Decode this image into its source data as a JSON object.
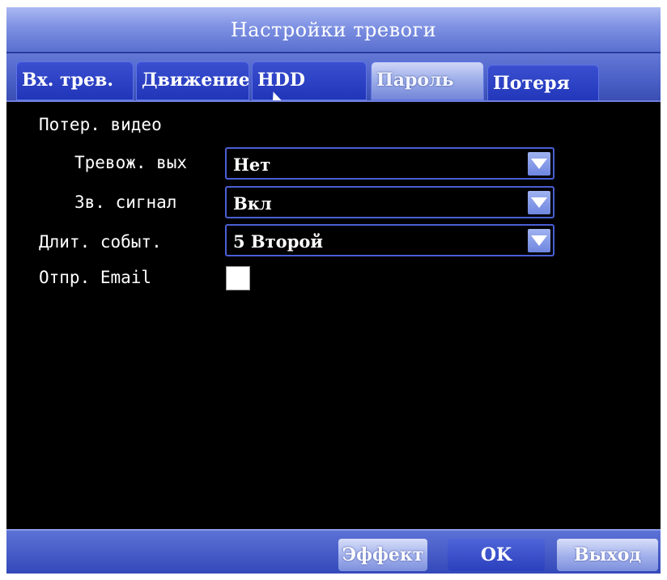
{
  "window": {
    "title": "Настройки тревоги"
  },
  "tabs": [
    {
      "label": "Вх. трев.",
      "state": "normal"
    },
    {
      "label": "Движение",
      "state": "normal"
    },
    {
      "label": "HDD",
      "state": "normal"
    },
    {
      "label": "Пароль",
      "state": "highlighted"
    },
    {
      "label": "Потеря",
      "state": "normal"
    }
  ],
  "section": {
    "heading": "Потер. видео"
  },
  "settings": {
    "alarm_out": {
      "label": "Тревож. вых",
      "value": "Нет"
    },
    "sound": {
      "label": "Зв. сигнал",
      "value": "Вкл"
    },
    "event_duration": {
      "label": "Длит. событ.",
      "value": "5 Второй"
    },
    "send_email": {
      "label": "Отпр. Email",
      "checked": false
    }
  },
  "buttons": {
    "effect": "Эффект",
    "ok": "OK",
    "exit": "Выход"
  },
  "colors": {
    "accent": "#4a5fd4",
    "titlebar": "#7d90e2",
    "background": "#000000"
  }
}
